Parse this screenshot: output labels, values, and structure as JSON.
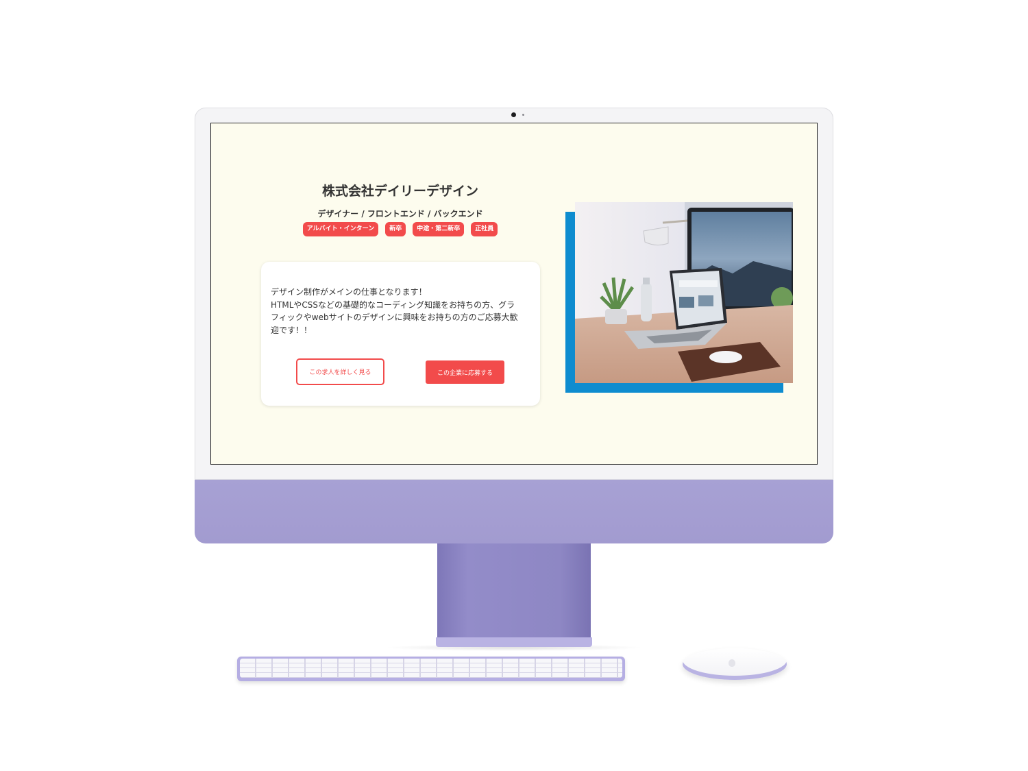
{
  "page": {
    "company_name": "株式会社デイリーデザイン",
    "job_roles": "デザイナー / フロントエンド / バックエンド",
    "tags": [
      "アルバイト・インターン",
      "新卒",
      "中途・第二新卒",
      "正社員"
    ],
    "description_lines": [
      "デザイン制作がメインの仕事となります！",
      "HTMLやCSSなどの基礎的なコーディング知識をお持ちの方、グラ",
      "フィックやwebサイトのデザインに興味をお持ちの方のご応募大歓",
      "迎です！！"
    ],
    "buttons": {
      "detail_label": "この求人を詳しく見る",
      "apply_label": "この企業に応募する"
    }
  },
  "colors": {
    "accent_red": "#f24b4b",
    "accent_blue": "#0e8ccf",
    "screen_background": "#fdfcee",
    "device_purple": "#a29bd0"
  }
}
